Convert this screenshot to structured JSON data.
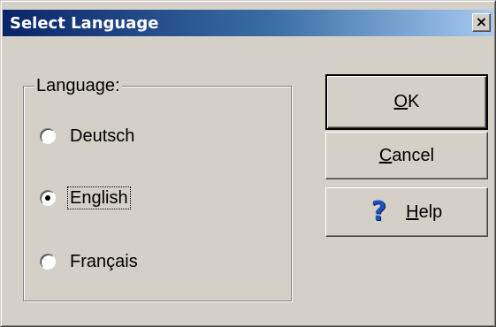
{
  "window": {
    "title": "Select Language",
    "close_glyph": "×"
  },
  "language_group": {
    "legend": "Language:",
    "options": [
      {
        "label": "Deutsch",
        "checked": false
      },
      {
        "label": "English",
        "checked": true,
        "focused": true
      },
      {
        "label": "Français",
        "checked": false
      }
    ]
  },
  "buttons": {
    "ok": {
      "mnemonic": "O",
      "rest": "K"
    },
    "cancel": {
      "mnemonic": "C",
      "rest": "ancel"
    },
    "help": {
      "mnemonic": "H",
      "rest": "elp",
      "icon": "question-mark-icon",
      "icon_glyph": "?"
    }
  },
  "colors": {
    "titlebar_start": "#0a246a",
    "titlebar_end": "#a6caf0",
    "face": "#d4d0c8",
    "help_icon": "#1f4fb8"
  }
}
